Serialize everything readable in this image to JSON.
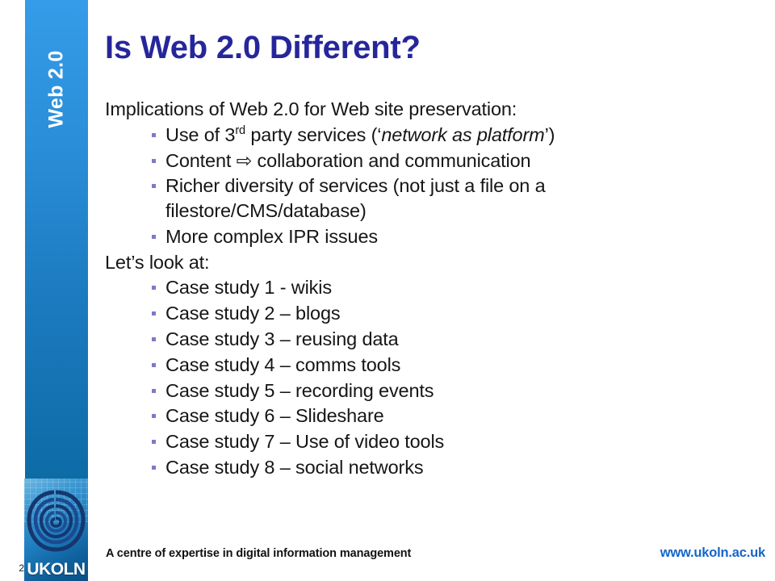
{
  "slide": {
    "number": "2",
    "title": "Is Web 2.0 Different?",
    "side_banner_label": "Web 2.0",
    "logo_wordmark": "UKOLN"
  },
  "colors": {
    "title": "#26269B",
    "banner_top": "#359CE9",
    "banner_bottom": "#0D6BA6",
    "bullet": "#7B7BC4",
    "body_text": "#161616",
    "footer_url": "#1565C8"
  },
  "content": {
    "intro": "Implications of Web 2.0 for Web site preservation:",
    "implications": [
      {
        "pre": "Use of 3",
        "sup": "rd",
        "mid": " party services (‘",
        "italic": "network as platform",
        "post": "’)"
      },
      {
        "text": "Content ⇨ collaboration and communication"
      },
      {
        "text": "Richer diversity of services (not just a file on a filestore/CMS/database)"
      },
      {
        "text": "More complex IPR issues"
      }
    ],
    "lets_look_at": "Let’s look at:",
    "case_studies": [
      "Case study 1 - wikis",
      "Case study 2 – blogs",
      "Case study 3 – reusing data",
      "Case study 4 – comms tools",
      "Case study 5 – recording events",
      "Case study 6 – Slideshare",
      "Case study 7 – Use of video tools",
      "Case study 8 – social networks"
    ]
  },
  "footer": {
    "tagline": "A centre of expertise in digital information management",
    "url": "www.ukoln.ac.uk"
  }
}
